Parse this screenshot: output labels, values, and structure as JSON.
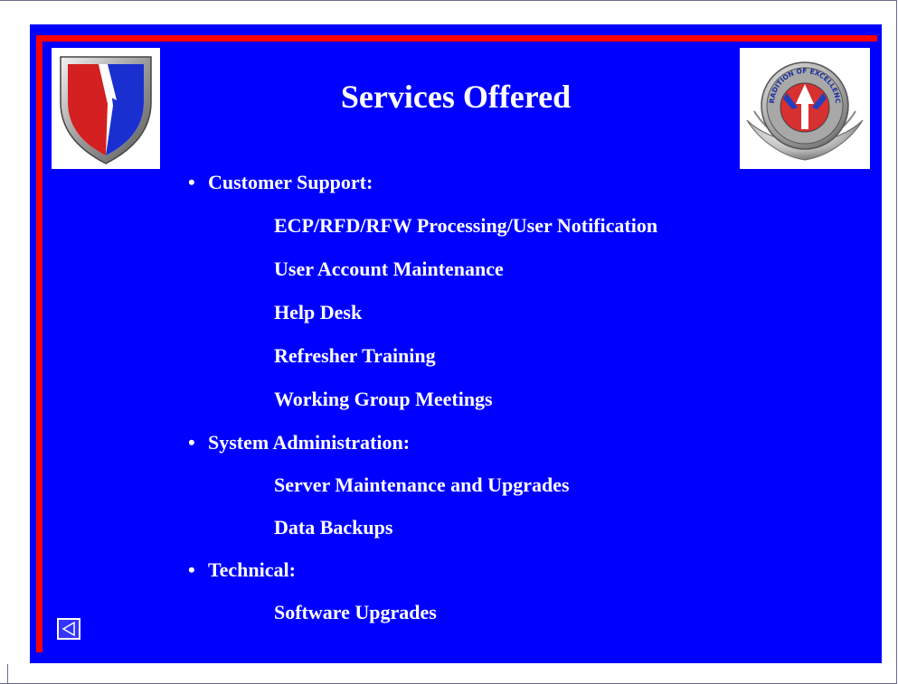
{
  "slide": {
    "title": "Services Offered",
    "colors": {
      "background": "#0000ff",
      "accent_stripe": "#ff0000",
      "text": "#ffffff"
    },
    "sections": [
      {
        "bullet": "•",
        "heading": "Customer Support:",
        "items": [
          "ECP/RFD/RFW Processing/User Notification",
          "User Account Maintenance",
          "Help Desk",
          "Refresher Training",
          "Working Group Meetings"
        ]
      },
      {
        "bullet": "•",
        "heading": "System Administration:",
        "items": [
          "Server Maintenance and Upgrades",
          "Data Backups"
        ]
      },
      {
        "bullet": "•",
        "heading": "Technical:",
        "items": [
          "Software Upgrades"
        ]
      }
    ],
    "logos": {
      "left": "shield-logo-icon",
      "right_icon": "tradition-of-excellence-insignia-icon",
      "right_text": "TRADITION OF EXCELLENCE"
    },
    "navigation": {
      "back_icon": "triangle-left-icon"
    }
  }
}
